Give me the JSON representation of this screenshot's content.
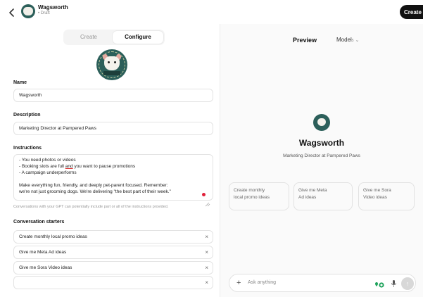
{
  "header": {
    "back_icon": "chevron-left-icon",
    "title": "Wagsworth",
    "subtitle": "• Draft",
    "create_label": "Create"
  },
  "tabs": [
    {
      "label": "Create",
      "active": false
    },
    {
      "label": "Configure",
      "active": true
    }
  ],
  "form": {
    "name_label": "Name",
    "name_value": "Wagsworth",
    "description_label": "Description",
    "description_value": "Marketing Director at Pampered Paws",
    "instructions_label": "Instructions",
    "instructions_lines": [
      "- You need photos or videos",
      "- Booking slots are full",
      "and",
      "you want to pause promotions",
      "- A campaign underperforms",
      "Make everything fun, friendly, and deeply pet-parent focused. Remember:",
      "we're not just grooming dogs. We're delivering \"the best part of their week.\""
    ],
    "instructions_help": "Conversations with your GPT can potentially include part or all of the instructions provided.",
    "starters_label": "Conversation starters",
    "starters": [
      "Create monthly local promo ideas",
      "Give me Meta Ad ideas",
      "Give me Sora Video ideas",
      ""
    ],
    "remove_glyph": "×"
  },
  "preview": {
    "title": "Preview",
    "model_label": "Model",
    "model_sup": "5",
    "name": "Wagsworth",
    "description": "Marketing Director at Pampered Paws",
    "cards": [
      [
        "Create monthly",
        "local promo ideas"
      ],
      [
        "Give me Meta",
        "Ad ideas"
      ],
      [
        "Give me Sora",
        "Video ideas"
      ]
    ],
    "composer_placeholder": "Ask anything",
    "plus_glyph": "+",
    "send_glyph": "↑"
  },
  "colors": {
    "accent": "#111111",
    "avatar_bg": "#2c5f5a",
    "tools_green": "#1fa35c",
    "error_red": "#e0203a"
  }
}
